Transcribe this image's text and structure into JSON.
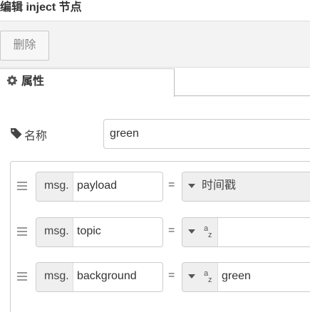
{
  "dialog": {
    "title": "编辑 inject 节点",
    "delete_label": "删除"
  },
  "tabs": [
    {
      "label": "属性",
      "icon": "gear-icon"
    }
  ],
  "name_field": {
    "icon": "tag-icon",
    "label": "名称",
    "value": "green"
  },
  "properties": [
    {
      "prefix": "msg.",
      "key": "payload",
      "operator": "=",
      "type_label": "时间戳",
      "type_icon": "",
      "value": ""
    },
    {
      "prefix": "msg.",
      "key": "topic",
      "operator": "=",
      "type_label": "",
      "type_icon": "string-az-icon",
      "value": ""
    },
    {
      "prefix": "msg.",
      "key": "background",
      "operator": "=",
      "type_label": "",
      "type_icon": "string-az-icon",
      "value": "green"
    }
  ]
}
